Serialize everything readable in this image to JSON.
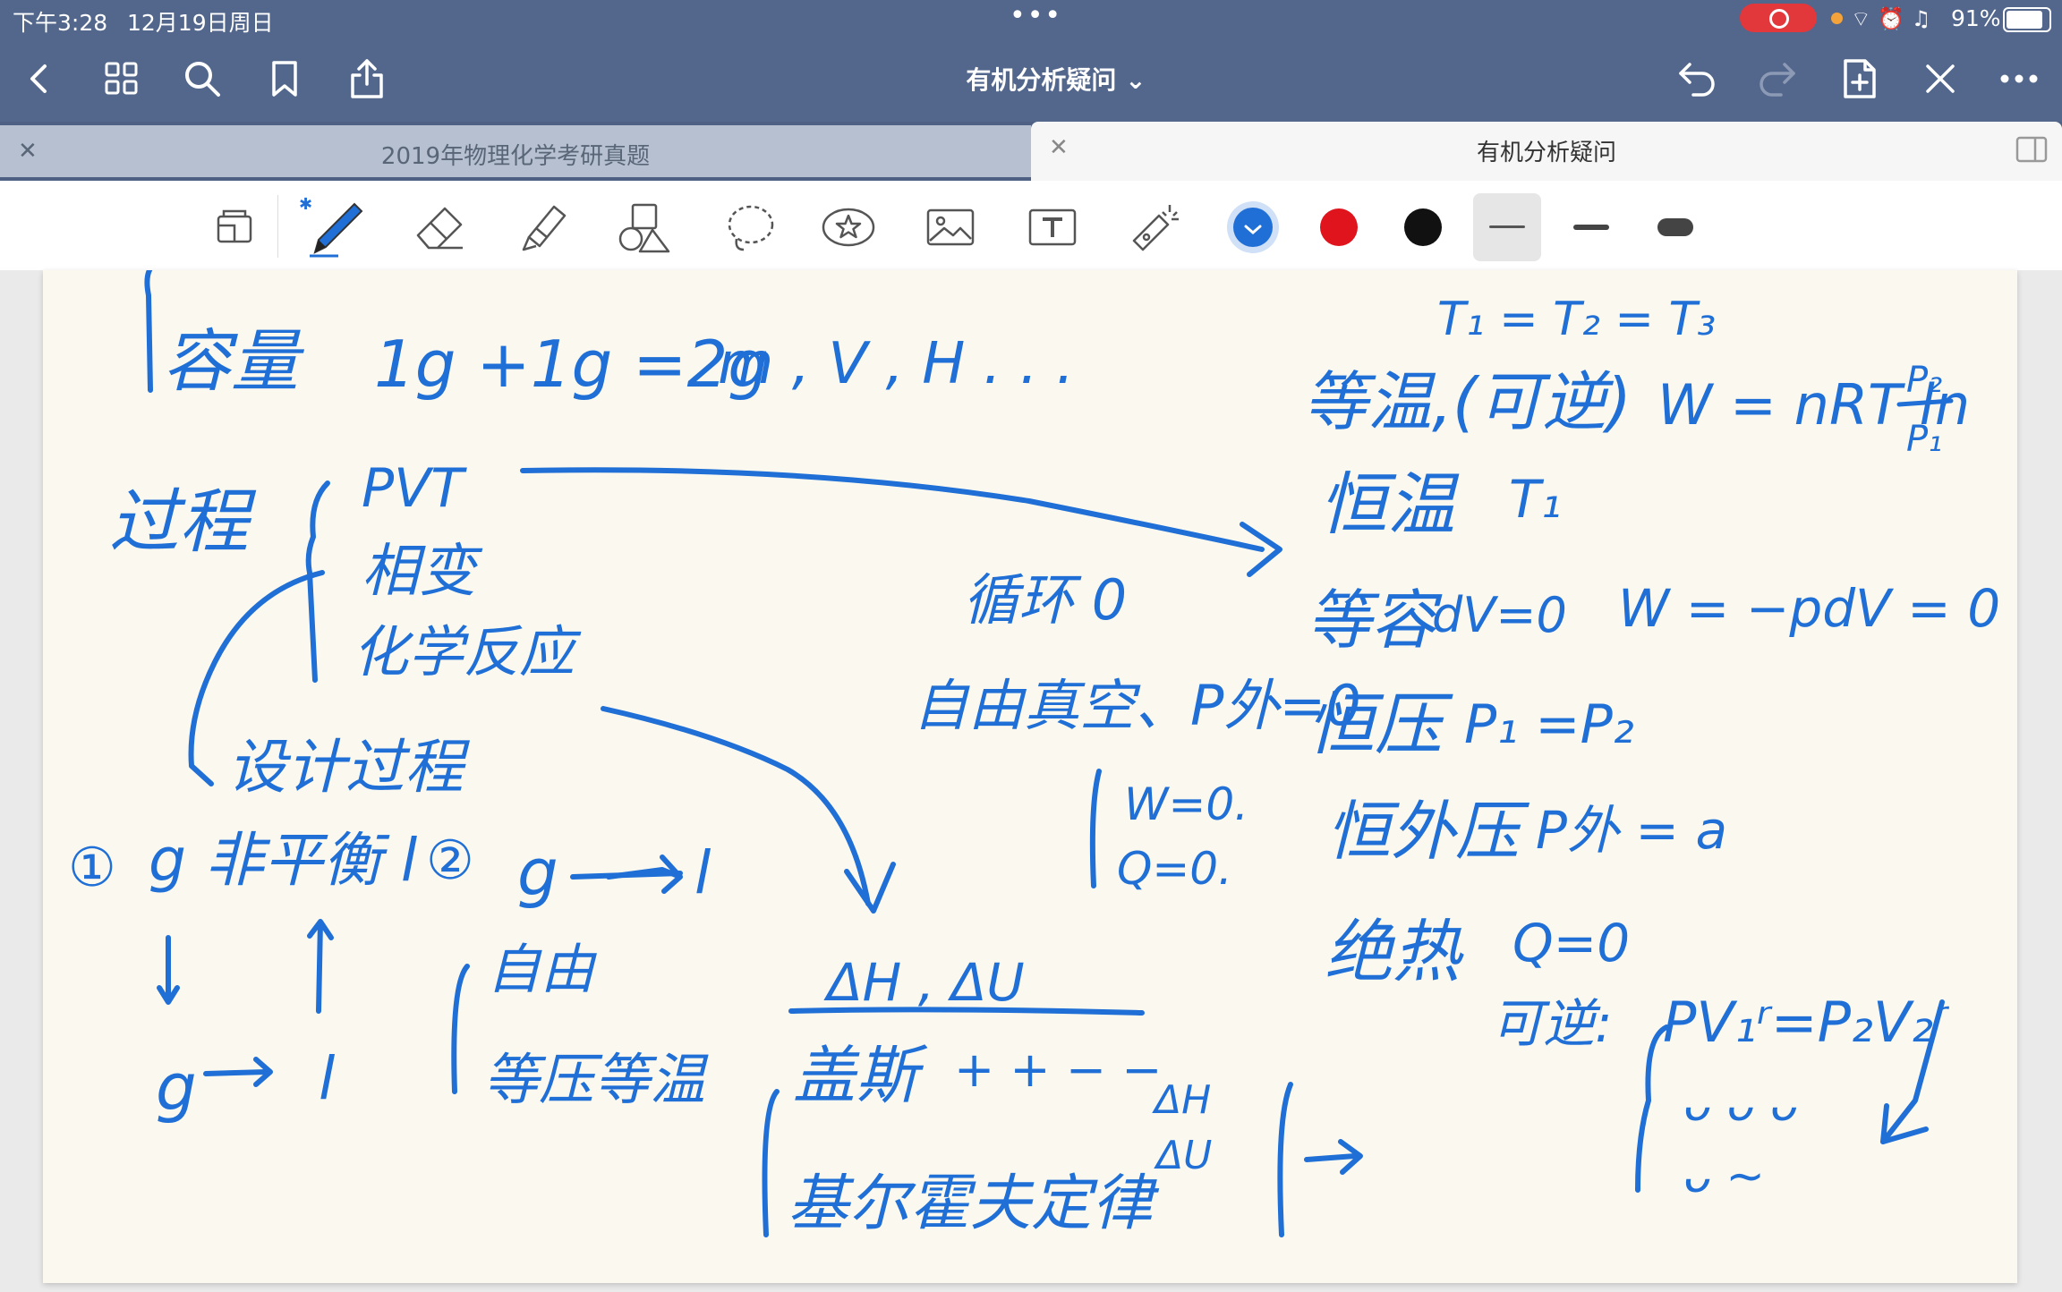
{
  "status": {
    "time": "下午3:28",
    "date": "12月19日周日",
    "battery": "91%"
  },
  "nav": {
    "title": "有机分析疑问",
    "icons": [
      "back-icon",
      "grid-icon",
      "search-icon",
      "bookmark-icon",
      "share-icon",
      "undo-icon",
      "redo-icon",
      "add-page-icon",
      "close-pen-icon",
      "more-icon"
    ]
  },
  "tabs": [
    {
      "label": "2019年物理化学考研真题",
      "active": false
    },
    {
      "label": "有机分析疑问",
      "active": true
    }
  ],
  "toolbar": {
    "tools": [
      "reader-mode",
      "pen",
      "eraser",
      "highlighter",
      "shapes",
      "lasso",
      "sticker",
      "image",
      "text",
      "laser"
    ],
    "colors": [
      "#1f6fd6",
      "#e0141c",
      "#111111"
    ],
    "strokes": [
      "thin",
      "medium",
      "thick"
    ]
  },
  "ink_color": "#1f6fd6",
  "note": {
    "lines": [
      "容量  1g + 1g = 2g   m、V、H ...",
      "过程 { PVT / 相变 / 化学反应",
      "设计过程",
      "① g 非平衡 l    ② g → l",
      "自由 / 等压等温",
      "ΔH , ΔU",
      "盖斯 + + − −",
      "基尔霍夫定律 ΔH ΔU",
      "循环 0",
      "自由真空、P外=0  W=0  Q=0",
      "T1 = T2 = T3",
      "等温、(可逆)  W = nRT ln P2/P1",
      "恒温 T1",
      "等容 dV=0   W = −pdV = 0",
      "恒压 P1 = P2",
      "恒外压 P外 = a",
      "绝热 Q=0",
      "可逆: P1V1^r = P2V2^r"
    ]
  }
}
